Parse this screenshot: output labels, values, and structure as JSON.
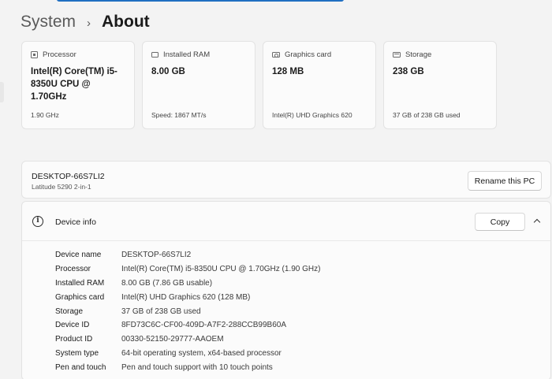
{
  "breadcrumb": {
    "parent": "System",
    "separator": "›",
    "current": "About"
  },
  "colors": {
    "accent": "#1f6fc2",
    "background": "#f3f3f3",
    "card": "#fbfbfb"
  },
  "cards": [
    {
      "icon": "processor-icon",
      "label": "Processor",
      "value": "Intel(R) Core(TM) i5-8350U CPU @ 1.70GHz",
      "sub": "1.90 GHz"
    },
    {
      "icon": "ram-icon",
      "label": "Installed RAM",
      "value": "8.00 GB",
      "sub": "Speed: 1867 MT/s"
    },
    {
      "icon": "graphics-card-icon",
      "label": "Graphics card",
      "value": "128 MB",
      "sub": "Intel(R) UHD Graphics 620"
    },
    {
      "icon": "storage-icon",
      "label": "Storage",
      "value": "238 GB",
      "sub": "37 GB of 238 GB used"
    }
  ],
  "pc": {
    "name": "DESKTOP-66S7LI2",
    "model": "Latitude 5290 2-in-1",
    "rename_label": "Rename this PC"
  },
  "device_info": {
    "title": "Device info",
    "copy_label": "Copy",
    "rows": [
      {
        "label": "Device name",
        "value": "DESKTOP-66S7LI2"
      },
      {
        "label": "Processor",
        "value": "Intel(R) Core(TM) i5-8350U CPU @ 1.70GHz (1.90 GHz)"
      },
      {
        "label": "Installed RAM",
        "value": "8.00 GB (7.86 GB usable)"
      },
      {
        "label": "Graphics card",
        "value": "Intel(R) UHD Graphics 620 (128 MB)"
      },
      {
        "label": "Storage",
        "value": "37 GB of 238 GB used"
      },
      {
        "label": "Device ID",
        "value": "8FD73C6C-CF00-409D-A7F2-288CCB99B60A"
      },
      {
        "label": "Product ID",
        "value": "00330-52150-29777-AAOEM"
      },
      {
        "label": "System type",
        "value": "64-bit operating system, x64-based processor"
      },
      {
        "label": "Pen and touch",
        "value": "Pen and touch support with 10 touch points"
      }
    ]
  }
}
